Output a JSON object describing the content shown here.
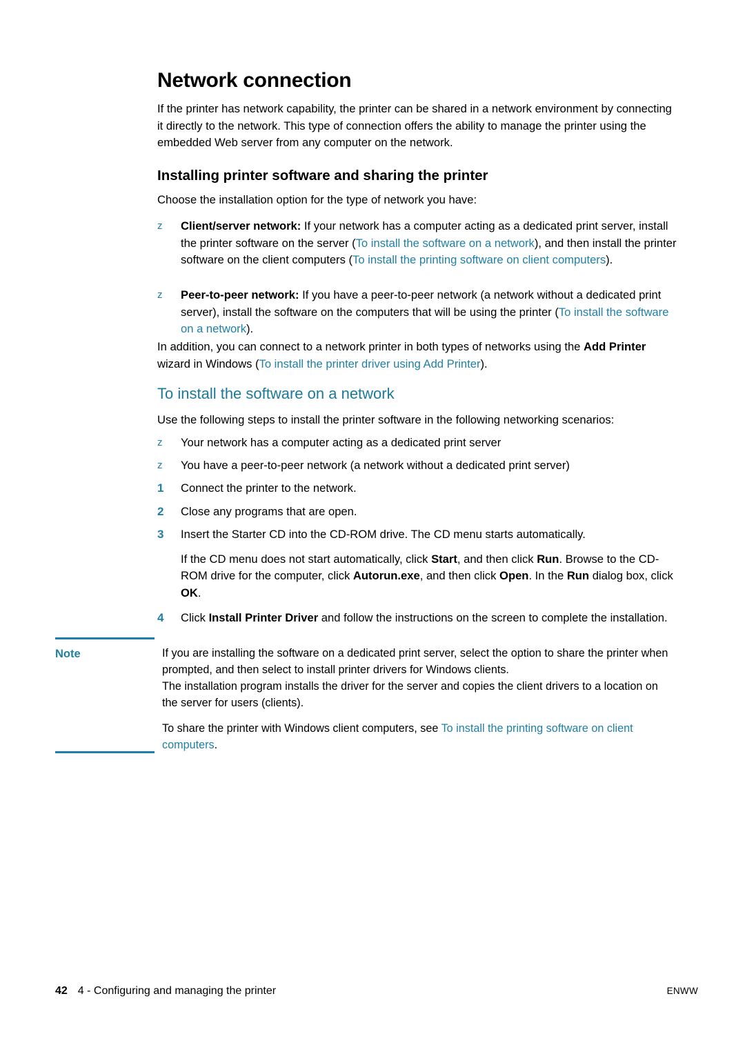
{
  "page": {
    "title": "Network connection",
    "intro": "If the printer has network capability, the printer can be shared in a network environment by connecting it directly to the network. This type of connection offers the ability to manage the printer using the embedded Web server from any computer on the network.",
    "bullet_glyph": "z",
    "colors": {
      "link": "#1f7fa6",
      "heading_teal": "#1b7a99",
      "rule": "#1f7fa6",
      "body_text": "#000000"
    }
  },
  "section_installing": {
    "heading": "Installing printer software and sharing the printer",
    "lead": "Choose the installation option for the type of network you have:",
    "bullets": [
      {
        "label": "Client/server network:",
        "parts": [
          {
            "text": " If your network has a computer acting as a dedicated print server, install the printer software on the server (",
            "style": "plain"
          },
          {
            "text": "To install the software on a network",
            "style": "link"
          },
          {
            "text": "), and then install the printer software on the client computers (",
            "style": "plain"
          },
          {
            "text": "To install the printing software on client computers",
            "style": "link"
          },
          {
            "text": ").",
            "style": "plain"
          }
        ]
      },
      {
        "label": "Peer-to-peer network:",
        "parts": [
          {
            "text": " If you have a peer-to-peer network (a network without a dedicated print server), install the software on the computers that will be using the printer (",
            "style": "plain"
          },
          {
            "text": "To install the software on a network",
            "style": "link"
          },
          {
            "text": ").",
            "style": "plain"
          }
        ]
      }
    ],
    "addition_paragraph": [
      {
        "text": "In addition, you can connect to a network printer in both types of networks using the ",
        "style": "plain"
      },
      {
        "text": "Add Printer",
        "style": "bold"
      },
      {
        "text": " wizard in Windows (",
        "style": "plain"
      },
      {
        "text": "To install the printer driver using Add Printer",
        "style": "link"
      },
      {
        "text": ").",
        "style": "plain"
      }
    ]
  },
  "section_install_network": {
    "heading": "To install the software on a network",
    "lead": "Use the following steps to install the printer software in the following networking scenarios:",
    "scenarios": [
      "Your network has a computer acting as a dedicated print server",
      "You have a peer-to-peer network (a network without a dedicated print server)"
    ],
    "steps": [
      {
        "number": "1",
        "parts": [
          {
            "text": "Connect the printer to the network.",
            "style": "plain"
          }
        ]
      },
      {
        "number": "2",
        "parts": [
          {
            "text": "Close any programs that are open.",
            "style": "plain"
          }
        ]
      },
      {
        "number": "3",
        "parts": [
          {
            "text": "Insert the Starter CD into the CD-ROM drive. The CD menu starts automatically.",
            "style": "plain"
          }
        ],
        "continuation": [
          {
            "text": "If the CD menu does not start automatically, click ",
            "style": "plain"
          },
          {
            "text": "Start",
            "style": "bold"
          },
          {
            "text": ", and then click ",
            "style": "plain"
          },
          {
            "text": "Run",
            "style": "bold"
          },
          {
            "text": ". Browse to the CD-ROM drive for the computer, click ",
            "style": "plain"
          },
          {
            "text": "Autorun.exe",
            "style": "bold"
          },
          {
            "text": ", and then click ",
            "style": "plain"
          },
          {
            "text": "Open",
            "style": "bold"
          },
          {
            "text": ". In the ",
            "style": "plain"
          },
          {
            "text": "Run",
            "style": "bold"
          },
          {
            "text": " dialog box, click ",
            "style": "plain"
          },
          {
            "text": "OK",
            "style": "bold"
          },
          {
            "text": ".",
            "style": "plain"
          }
        ]
      },
      {
        "number": "4",
        "parts": [
          {
            "text": "Click ",
            "style": "plain"
          },
          {
            "text": "Install Printer Driver",
            "style": "bold"
          },
          {
            "text": " and follow the instructions on the screen to complete the installation.",
            "style": "plain"
          }
        ]
      }
    ]
  },
  "note": {
    "label": "Note",
    "paragraph_1": "If you are installing the software on a dedicated print server, select the option to share the printer when prompted, and then select to install printer drivers for Windows clients.",
    "paragraph_2": "The installation program installs the driver for the server and copies the client drivers to a location on the server for users (clients).",
    "paragraph_3": [
      {
        "text": "To share the printer with Windows client computers, see ",
        "style": "plain"
      },
      {
        "text": "To install the printing software on client computers",
        "style": "link"
      },
      {
        "text": ".",
        "style": "plain"
      }
    ]
  },
  "footer": {
    "page_number": "42",
    "chapter": "4 - Configuring and managing the printer",
    "locale": "ENWW"
  }
}
